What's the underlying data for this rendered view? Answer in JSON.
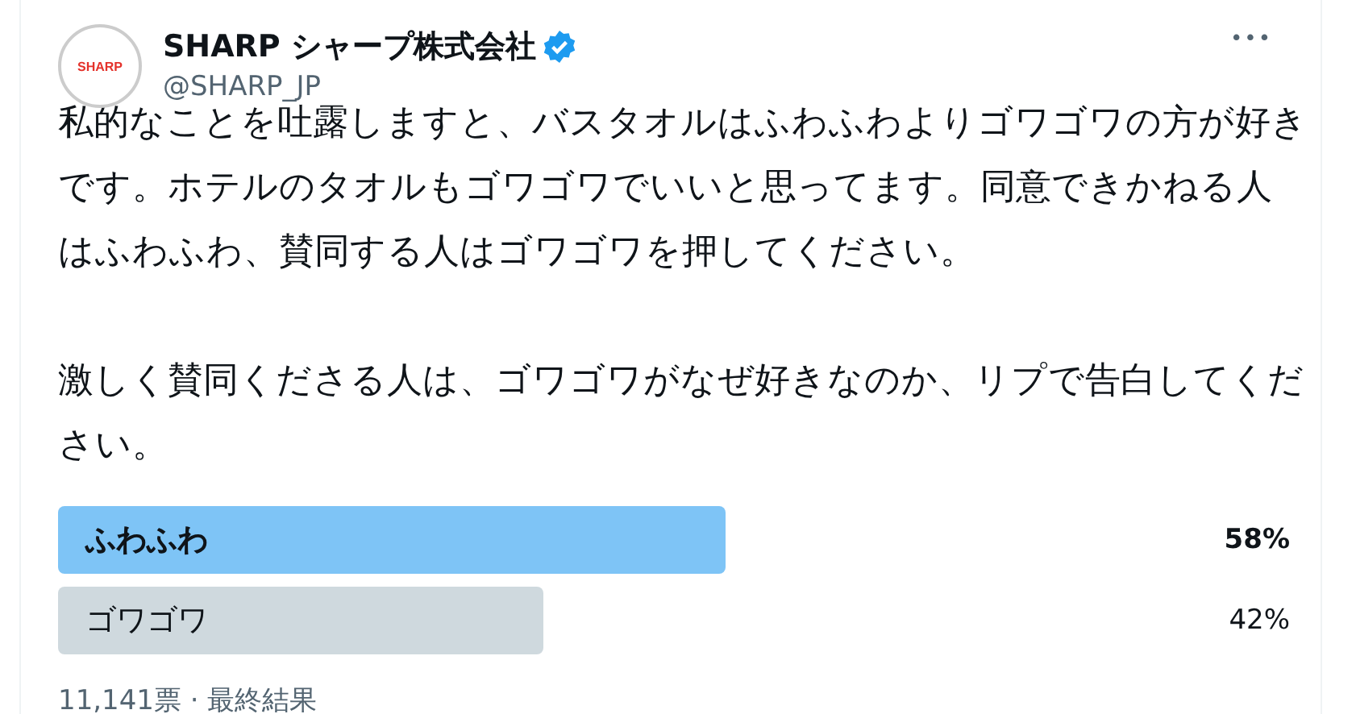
{
  "author": {
    "name": "SHARP シャープ株式会社",
    "verified": true,
    "handle": "@SHARP_JP",
    "avatar_text": "SHARP"
  },
  "more_menu": "•••",
  "paragraphs": [
    "私的なことを吐露しますと、バスタオルはふわふわよりゴワゴワの方が好きです。ホテルのタオルもゴワゴワでいいと思ってます。同意できかねる人はふわふわ、賛同する人はゴワゴワを押してください。",
    "激しく賛同くださる人は、ゴワゴワがなぜ好きなのか、リプで告白してください。"
  ],
  "poll": {
    "options": [
      {
        "label": "ふわふわ",
        "percent": "58%",
        "winner": true
      },
      {
        "label": "ゴワゴワ",
        "percent": "42%",
        "winner": false
      }
    ],
    "summary": "11,141票 · 最終結果"
  }
}
